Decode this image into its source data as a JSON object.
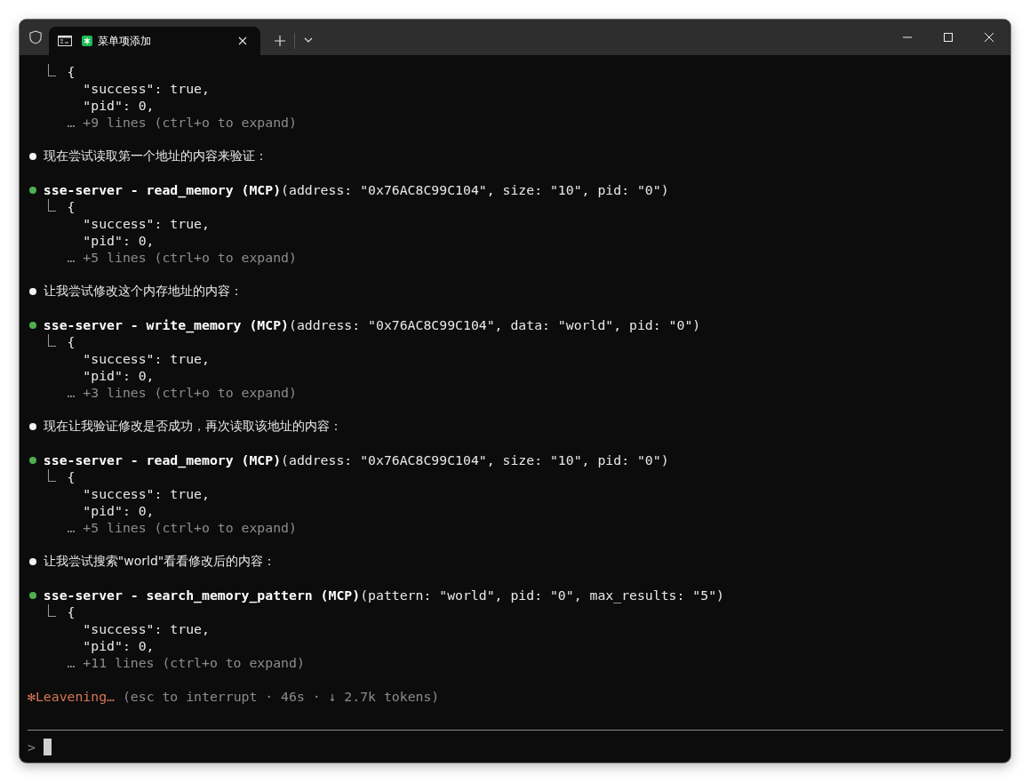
{
  "window": {
    "tab": {
      "title": "菜单项添加",
      "selected": true
    }
  },
  "entries": [
    {
      "kind": "result",
      "open": "{",
      "lines": [
        "\"success\": true,",
        "\"pid\": 0,"
      ],
      "more": "… +9 lines (ctrl+o to expand)"
    },
    {
      "kind": "message",
      "text": "现在尝试读取第一个地址的内容来验证："
    },
    {
      "kind": "tool",
      "name": "sse-server - read_memory (MCP)",
      "args": "(address: \"0x76AC8C99C104\", size: \"10\", pid: \"0\")",
      "result": {
        "open": "{",
        "lines": [
          "\"success\": true,",
          "\"pid\": 0,"
        ],
        "more": "… +5 lines (ctrl+o to expand)"
      }
    },
    {
      "kind": "message",
      "text": "让我尝试修改这个内存地址的内容："
    },
    {
      "kind": "tool",
      "name": "sse-server - write_memory (MCP)",
      "args": "(address: \"0x76AC8C99C104\", data: \"world\", pid: \"0\")",
      "result": {
        "open": "{",
        "lines": [
          "\"success\": true,",
          "\"pid\": 0,"
        ],
        "more": "… +3 lines (ctrl+o to expand)"
      }
    },
    {
      "kind": "message",
      "text": "现在让我验证修改是否成功，再次读取该地址的内容："
    },
    {
      "kind": "tool",
      "name": "sse-server - read_memory (MCP)",
      "args": "(address: \"0x76AC8C99C104\", size: \"10\", pid: \"0\")",
      "result": {
        "open": "{",
        "lines": [
          "\"success\": true,",
          "\"pid\": 0,"
        ],
        "more": "… +5 lines (ctrl+o to expand)"
      }
    },
    {
      "kind": "message",
      "text": "让我尝试搜索\"world\"看看修改后的内容："
    },
    {
      "kind": "tool",
      "name": "sse-server - search_memory_pattern (MCP)",
      "args": "(pattern: \"world\", pid: \"0\", max_results: \"5\")",
      "result": {
        "open": "{",
        "lines": [
          "\"success\": true,",
          "\"pid\": 0,"
        ],
        "more": "… +11 lines (ctrl+o to expand)"
      }
    }
  ],
  "status": {
    "spinner": "✻",
    "label": "Leavening…",
    "detail": "(esc to interrupt · 46s · ↓ 2.7k tokens)"
  },
  "prompt": {
    "symbol": ">"
  }
}
